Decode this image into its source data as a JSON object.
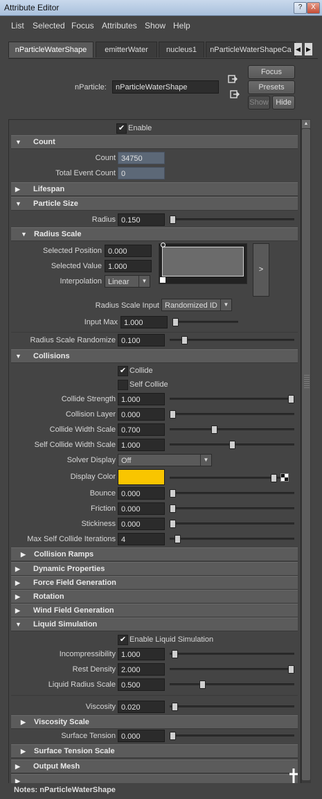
{
  "window": {
    "title": "Attribute Editor",
    "help_btn": "?",
    "close_btn": "X"
  },
  "menu": [
    "List",
    "Selected",
    "Focus",
    "Attributes",
    "Show",
    "Help"
  ],
  "tabs": [
    "nParticleWaterShape",
    "emitterWater",
    "nucleus1",
    "nParticleWaterShapeCa"
  ],
  "tab_arrows": {
    "left": "◀",
    "right": "▶"
  },
  "header": {
    "node_label": "nParticle:",
    "node_value": "nParticleWaterShape",
    "focus": "Focus",
    "presets": "Presets",
    "show": "Show",
    "hide": "Hide",
    "load_icon": "load-icon",
    "copy_icon": "copy-icon"
  },
  "enable": {
    "label": "Enable",
    "checked": "✔"
  },
  "sections": {
    "count": {
      "title": "Count",
      "arrow": "▼"
    },
    "lifespan": {
      "title": "Lifespan",
      "arrow": "▶"
    },
    "particle_size": {
      "title": "Particle Size",
      "arrow": "▼"
    },
    "radius_scale": {
      "title": "Radius Scale",
      "arrow": "▼"
    },
    "collisions": {
      "title": "Collisions",
      "arrow": "▼"
    },
    "collision_ramps": {
      "title": "Collision Ramps",
      "arrow": "▶"
    },
    "dynamic_properties": {
      "title": "Dynamic Properties",
      "arrow": "▶"
    },
    "force_field_generation": {
      "title": "Force Field Generation",
      "arrow": "▶"
    },
    "rotation": {
      "title": "Rotation",
      "arrow": "▶"
    },
    "wind_field_generation": {
      "title": "Wind Field Generation",
      "arrow": "▶"
    },
    "liquid_simulation": {
      "title": "Liquid Simulation",
      "arrow": "▼"
    },
    "viscosity_scale": {
      "title": "Viscosity Scale",
      "arrow": "▶"
    },
    "surface_tension_scale": {
      "title": "Surface Tension Scale",
      "arrow": "▶"
    },
    "output_mesh": {
      "title": "Output Mesh",
      "arrow": "▶"
    }
  },
  "count": {
    "count_label": "Count",
    "count_value": "34750",
    "total_label": "Total Event Count",
    "total_value": "0"
  },
  "particle_size": {
    "radius_label": "Radius",
    "radius_value": "0.150",
    "radius_slider": 0.0
  },
  "radius_scale": {
    "sel_pos_label": "Selected Position",
    "sel_pos_value": "0.000",
    "sel_val_label": "Selected Value",
    "sel_val_value": "1.000",
    "interp_label": "Interpolation",
    "interp_value": "Linear",
    "ramp_button": ">",
    "input_label": "Radius Scale Input",
    "input_value": "Randomized ID",
    "input_max_label": "Input Max",
    "input_max_value": "1.000",
    "input_max_slider": 0.0,
    "randomize_label": "Radius Scale Randomize",
    "randomize_value": "0.100",
    "randomize_slider": 0.1
  },
  "collisions": {
    "collide_label": "Collide",
    "collide_checked": "✔",
    "self_collide_label": "Self Collide",
    "strength_label": "Collide Strength",
    "strength_value": "1.000",
    "strength_slider": 1.0,
    "layer_label": "Collision Layer",
    "layer_value": "0.000",
    "layer_slider": 0.0,
    "width_label": "Collide Width Scale",
    "width_value": "0.700",
    "width_slider": 0.35,
    "self_width_label": "Self Collide Width Scale",
    "self_width_value": "1.000",
    "self_width_slider": 0.5,
    "solver_label": "Solver Display",
    "solver_value": "Off",
    "color_label": "Display Color",
    "color_value": "#f9c500",
    "color_slider": 0.97,
    "bounce_label": "Bounce",
    "bounce_value": "0.000",
    "bounce_slider": 0.0,
    "friction_label": "Friction",
    "friction_value": "0.000",
    "friction_slider": 0.0,
    "stickiness_label": "Stickiness",
    "stickiness_value": "0.000",
    "stickiness_slider": 0.0,
    "iterations_label": "Max Self Collide Iterations",
    "iterations_value": "4",
    "iterations_slider": 0.04
  },
  "liquid": {
    "enable_label": "Enable Liquid Simulation",
    "enable_checked": "✔",
    "incomp_label": "Incompressibility",
    "incomp_value": "1.000",
    "incomp_slider": 0.02,
    "rest_label": "Rest Density",
    "rest_value": "2.000",
    "rest_slider": 1.0,
    "radius_label": "Liquid Radius Scale",
    "radius_value": "0.500",
    "radius_slider": 0.25,
    "viscosity_label": "Viscosity",
    "viscosity_value": "0.020",
    "viscosity_slider": 0.02,
    "tension_label": "Surface Tension",
    "tension_value": "0.000",
    "tension_slider": 0.0
  },
  "notes": {
    "label": "Notes:  nParticleWaterShape"
  }
}
